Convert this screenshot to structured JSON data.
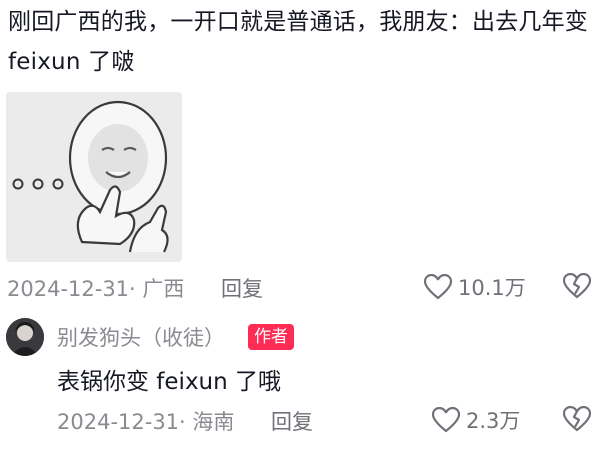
{
  "comment": {
    "text": "刚回广西的我，一开口就是普通话，我朋友：出去几年变 feixun 了啵",
    "sticker_icon": "smiling-face-meme-sticker",
    "date": "2024-12-31· 广西",
    "reply_label": "回复",
    "like_count": "10.1万",
    "like_icon": "heart-outline-icon",
    "dislike_icon": "broken-heart-icon"
  },
  "reply": {
    "avatar_icon": "user-avatar",
    "username": "别发狗头（收徒）",
    "author_badge": "作者",
    "text": "表锅你变 feixun 了哦",
    "date": "2024-12-31· 海南",
    "reply_label": "回复",
    "like_count": "2.3万",
    "like_icon": "heart-outline-icon",
    "dislike_icon": "broken-heart-icon"
  },
  "colors": {
    "text_primary": "#161823",
    "text_secondary": "#8a8b91",
    "badge": "#fe2c55",
    "icon": "#6f7078"
  }
}
